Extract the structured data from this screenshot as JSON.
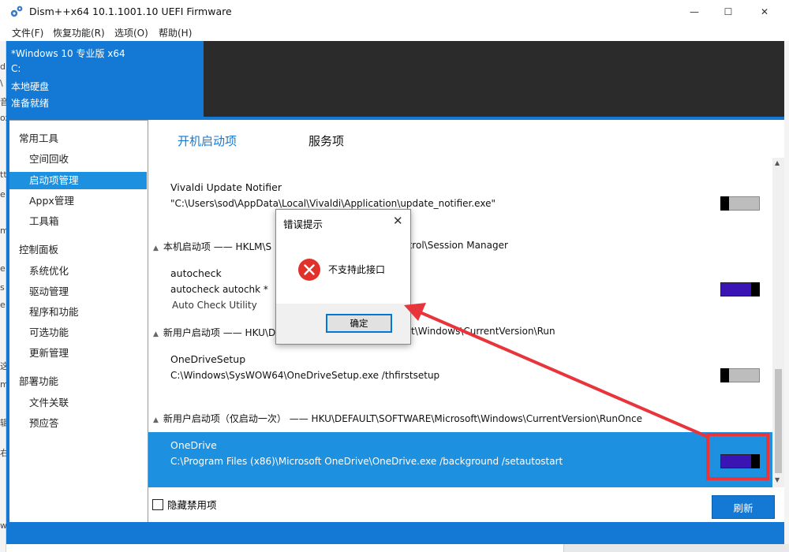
{
  "window": {
    "title": "Dism++x64 10.1.1001.10 UEFI Firmware",
    "controls": {
      "minimize": "—",
      "maximize": "☐",
      "close": "✕"
    }
  },
  "menu": [
    "文件(F)",
    "恢复功能(R)",
    "选项(O)",
    "帮助(H)"
  ],
  "system_info": {
    "os": "*Windows 10 专业版 x64",
    "drive": "C:",
    "disk_type": "本地硬盘",
    "status": "准备就绪"
  },
  "left_strip_chars": [
    "d",
    "\\",
    "音",
    "ox",
    "tt",
    "e",
    "m",
    "e",
    "s",
    "e",
    "这",
    "m",
    "辑",
    "右",
    "w"
  ],
  "sidebar": {
    "sections": [
      {
        "title": "常用工具",
        "items": [
          "空间回收",
          "启动项管理",
          "Appx管理",
          "工具箱"
        ]
      },
      {
        "title": "控制面板",
        "items": [
          "系统优化",
          "驱动管理",
          "程序和功能",
          "可选功能",
          "更新管理"
        ]
      },
      {
        "title": "部署功能",
        "items": [
          "文件关联",
          "预应答"
        ]
      }
    ],
    "active_item": "启动项管理"
  },
  "tabs": {
    "startup": "开机启动项",
    "services": "服务项"
  },
  "entries": {
    "vivaldi": {
      "name": "Vivaldi Update Notifier",
      "path": "\"C:\\Users\\sod\\AppData\\Local\\Vivaldi\\Application\\update_notifier.exe\"",
      "enabled": false
    },
    "group_session": {
      "label": "本机启动项 —— HKLM\\S",
      "label_tail": "ntrol\\Session Manager"
    },
    "autocheck": {
      "name": "autocheck",
      "path": "autocheck autochk *",
      "desc": "Auto Check Utility",
      "enabled": true
    },
    "group_run": {
      "label": "新用户启动项 —— HKU\\D",
      "label_tail": "t\\Windows\\CurrentVersion\\Run"
    },
    "onedrive_setup": {
      "name": "OneDriveSetup",
      "path": "C:\\Windows\\SysWOW64\\OneDriveSetup.exe /thfirstsetup",
      "enabled": false
    },
    "group_runonce": {
      "label": "新用户启动项（仅启动一次） —— HKU\\DEFAULT\\SOFTWARE\\Microsoft\\Windows\\CurrentVersion\\RunOnce"
    },
    "onedrive": {
      "name": "OneDrive",
      "path": "C:\\Program Files (x86)\\Microsoft OneDrive\\OneDrive.exe /background /setautostart",
      "enabled": true
    }
  },
  "footer": {
    "hide_disabled": "隐藏禁用项",
    "refresh": "刷新"
  },
  "dialog": {
    "title": "错误提示",
    "message": "不支持此接口",
    "ok": "确定"
  },
  "colors": {
    "accent": "#1479d4",
    "selected_row": "#1e90e0",
    "toggle_on": "#3b14b4",
    "annotation": "#e8343b"
  },
  "icons": [
    "gear-icon",
    "error-icon",
    "close-icon",
    "collapse-arrow-icon"
  ]
}
